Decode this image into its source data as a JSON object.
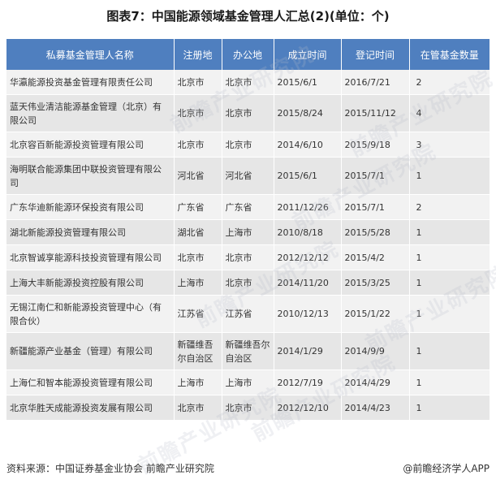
{
  "title": "图表7：中国能源领域基金管理人汇总(2)(单位：个)",
  "table": {
    "headers": [
      "私募基金管理人名称",
      "注册地",
      "办公地",
      "成立时间",
      "登记时间",
      "在管基金数量"
    ],
    "rows": [
      {
        "name": "华瀛能源投资基金管理有限责任公司",
        "reg": "北京市",
        "office": "北京市",
        "founded": "2015/6/1",
        "registered": "2016/7/21",
        "count": "2"
      },
      {
        "name": "蓝天伟业清洁能源基金管理（北京）有限公司",
        "reg": "北京市",
        "office": "北京市",
        "founded": "2015/8/24",
        "registered": "2015/11/12",
        "count": "4"
      },
      {
        "name": "北京容百新能源投资管理有限公司",
        "reg": "北京市",
        "office": "北京市",
        "founded": "2014/6/10",
        "registered": "2015/9/18",
        "count": "3"
      },
      {
        "name": "海明联合能源集团中联投资管理有限公司",
        "reg": "河北省",
        "office": "河北省",
        "founded": "2015/6/1",
        "registered": "2015/7/1",
        "count": "1"
      },
      {
        "name": "广东华迪新能源环保投资有限公司",
        "reg": "广东省",
        "office": "广东省",
        "founded": "2011/12/26",
        "registered": "2015/7/1",
        "count": "2"
      },
      {
        "name": "湖北新能源投资管理有限公司",
        "reg": "湖北省",
        "office": "上海市",
        "founded": "2010/8/18",
        "registered": "2015/5/28",
        "count": "1"
      },
      {
        "name": "北京智诚享能源科技投资管理有限公司",
        "reg": "北京市",
        "office": "北京市",
        "founded": "2012/12/12",
        "registered": "2015/4/2",
        "count": "1"
      },
      {
        "name": "上海大丰新能源投资控股有限公司",
        "reg": "上海市",
        "office": "北京市",
        "founded": "2014/11/20",
        "registered": "2015/3/25",
        "count": "1"
      },
      {
        "name": "无锡江南仁和新能源投资管理中心（有限合伙）",
        "reg": "江苏省",
        "office": "江苏省",
        "founded": "2010/12/13",
        "registered": "2015/1/22",
        "count": "1"
      },
      {
        "name": "新疆能源产业基金（管理）有限公司",
        "reg": "新疆维吾尔自治区",
        "office": "新疆维吾尔自治区",
        "founded": "2014/1/29",
        "registered": "2014/9/9",
        "count": "1"
      },
      {
        "name": "上海仁和智本能源投资管理有限公司",
        "reg": "上海市",
        "office": "上海市",
        "founded": "2012/7/19",
        "registered": "2014/4/29",
        "count": "1"
      },
      {
        "name": "北京华胜天成能源投资发展有限公司",
        "reg": "北京市",
        "office": "北京市",
        "founded": "2012/12/10",
        "registered": "2014/4/23",
        "count": "1"
      }
    ]
  },
  "watermark": "前瞻产业研究院",
  "footer": {
    "source": "资料来源：中国证券基金业协会 前瞻产业研究院",
    "credit": "@前瞻经济学人APP"
  },
  "colors": {
    "header_bg": "#4f7fbf",
    "row_odd": "#f2f2f2",
    "row_even": "#e6e6e6"
  }
}
